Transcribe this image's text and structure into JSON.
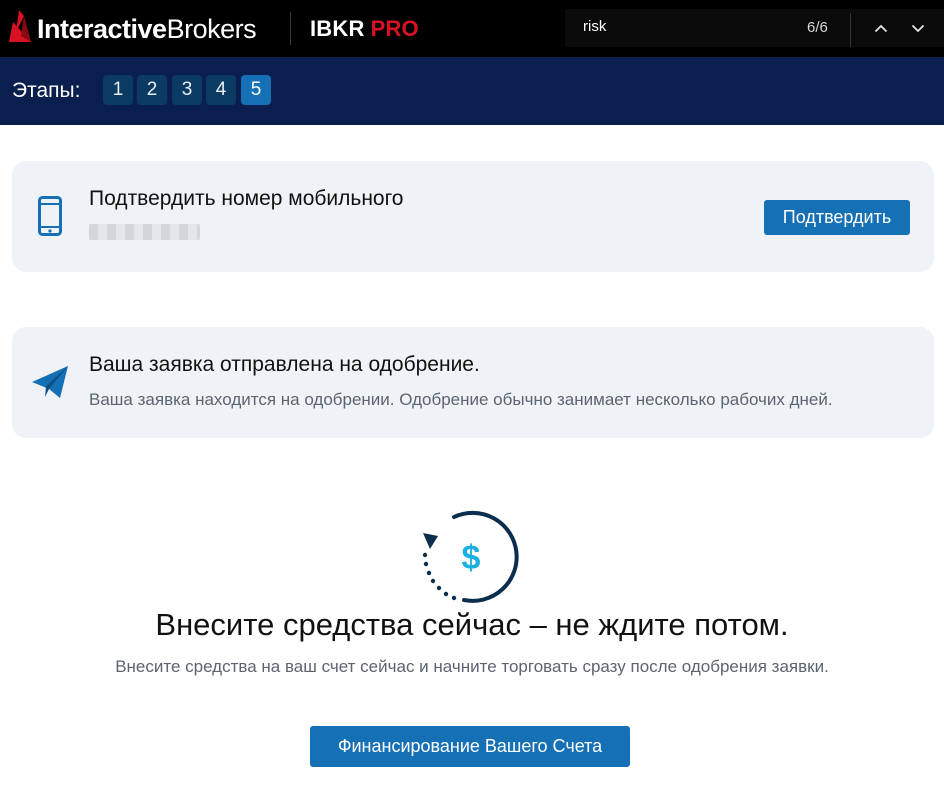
{
  "header": {
    "brand_prefix": "Interactive",
    "brand_suffix": "Brokers",
    "product": "IBKR",
    "product_suffix": "PRO"
  },
  "findbar": {
    "query": "risk",
    "count": "6/6",
    "up_icon": "chevron-up-icon",
    "down_icon": "chevron-down-icon"
  },
  "steps": {
    "label": "Этапы:",
    "items": [
      "1",
      "2",
      "3",
      "4",
      "5"
    ],
    "active": "5"
  },
  "phone_card": {
    "icon": "mobile-phone-icon",
    "title": "Подтвердить номер мобильного",
    "button_label": "Подтвердить"
  },
  "status_card": {
    "icon": "paper-plane-icon",
    "title": "Ваша заявка отправлена на одобрение.",
    "subtitle": "Ваша заявка находится на одобрении. Одобрение обычно занимает несколько рабочих дней."
  },
  "funding": {
    "icon": "dollar-refresh-icon",
    "title": "Внесите средства сейчас – не ждите потом.",
    "subtitle": "Внесите средства на ваш счет сейчас и начните торговать сразу после одобрения заявки.",
    "button_label": "Финансирование Вашего Счета"
  },
  "colors": {
    "topbar": "#000000",
    "steps_bar": "#0a1f4e",
    "step_inactive": "#0b3b63",
    "accent": "#1670b5",
    "brand_red": "#d81222",
    "card_bg": "#eff3f8",
    "icon_teal": "#1ab0e0"
  }
}
